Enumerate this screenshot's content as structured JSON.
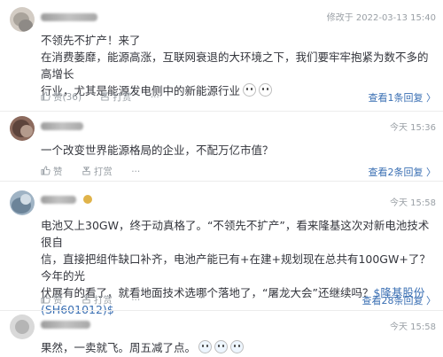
{
  "comments": [
    {
      "time": "修改于 2022-03-13 15:40",
      "line1": "不领先不扩产！来了",
      "line2": "在消费萎靡，能源高涨，互联网衰退的大环境之下，我们要牢牢抱紧为数不多的高增长",
      "line3": "行业，尤其是能源发电侧中的新能源行业",
      "like_label": "赞(36)",
      "tip_label": "打赏",
      "more_label": "···",
      "reply_label": "查看1条回复 〉"
    },
    {
      "time": "今天 15:36",
      "line1": "一个改变世界能源格局的企业，不配万亿市值？",
      "like_label": "赞",
      "tip_label": "打赏",
      "more_label": "···",
      "reply_label": "查看2条回复 〉"
    },
    {
      "time": "今天 15:58",
      "line1": "电池又上30GW，终于动真格了。“不领先不扩产”，看来隆基这次对新电池技术很自",
      "line2": "信，直接把组件缺口补齐，电池产能已有+在建+规划现在总共有100GW+了？今年的光",
      "line3_pre": "伏展有的看了，就看地面技术选哪个落地了，“屠龙大会”还继续吗？",
      "stock_link": "$隆基股份",
      "stock_code": "(SH601012)$",
      "like_label": "赞",
      "tip_label": "打赏",
      "more_label": "···",
      "reply_label": "查看28条回复 〉"
    },
    {
      "time": "今天 15:58",
      "line1": "果然，一卖就飞。周五减了点。"
    }
  ]
}
